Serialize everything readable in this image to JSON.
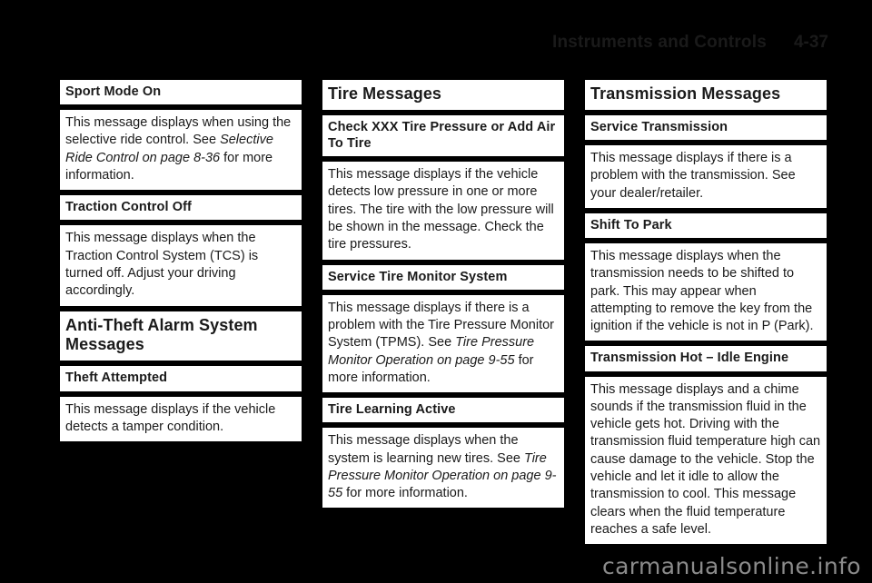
{
  "header": {
    "title": "Instruments and Controls",
    "folio": "4-37"
  },
  "columns": [
    {
      "id": "column-1",
      "blocks": [
        {
          "kind": "msg-title",
          "name": "heading-sport-mode-on",
          "text": "Sport Mode On"
        },
        {
          "kind": "body",
          "name": "body-sport-mode-on",
          "runs": [
            {
              "style": "normal",
              "text": "This message displays when using the selective ride control. See "
            },
            {
              "style": "italic",
              "text": "Selective Ride Control on page 8-36 "
            },
            {
              "style": "normal",
              "text": "for more information."
            }
          ]
        },
        {
          "kind": "msg-title",
          "name": "heading-traction-control-off",
          "text": "Traction Control Off"
        },
        {
          "kind": "body",
          "name": "body-traction-control-off",
          "runs": [
            {
              "style": "normal",
              "text": "This message displays when the Traction Control System (TCS) is turned off. Adjust your driving accordingly."
            }
          ]
        },
        {
          "kind": "sec-title",
          "name": "heading-anti-theft-alarm-system-messages",
          "text": "Anti-Theft Alarm System Messages"
        },
        {
          "kind": "msg-title",
          "name": "heading-theft-attempted",
          "text": "Theft Attempted"
        },
        {
          "kind": "body",
          "name": "body-theft-attempted",
          "runs": [
            {
              "style": "normal",
              "text": "This message displays if the vehicle detects a tamper condition."
            }
          ]
        }
      ]
    },
    {
      "id": "column-2",
      "blocks": [
        {
          "kind": "sec-title",
          "name": "heading-tire-messages",
          "text": "Tire Messages"
        },
        {
          "kind": "msg-title",
          "name": "heading-check-xxx-tire-pressure",
          "text": "Check XXX Tire Pressure or Add Air To Tire"
        },
        {
          "kind": "body",
          "name": "body-check-xxx-tire-pressure",
          "runs": [
            {
              "style": "normal",
              "text": "This message displays if the vehicle detects low pressure in one or more tires. The tire with the low pressure will be shown in the message. Check the tire pressures."
            }
          ]
        },
        {
          "kind": "msg-title",
          "name": "heading-service-tire-monitor-system",
          "text": "Service Tire Monitor System"
        },
        {
          "kind": "body",
          "name": "body-service-tire-monitor-system",
          "runs": [
            {
              "style": "normal",
              "text": "This message displays if there is a problem with the Tire Pressure Monitor System (TPMS). See "
            },
            {
              "style": "italic",
              "text": "Tire Pressure Monitor Operation on page 9-55 "
            },
            {
              "style": "normal",
              "text": "for more information."
            }
          ]
        },
        {
          "kind": "msg-title",
          "name": "heading-tire-learning-active",
          "text": "Tire Learning Active"
        },
        {
          "kind": "body",
          "name": "body-tire-learning-active",
          "runs": [
            {
              "style": "normal",
              "text": "This message displays when the system is learning new tires. See "
            },
            {
              "style": "italic",
              "text": "Tire Pressure Monitor Operation on page 9-55 "
            },
            {
              "style": "normal",
              "text": "for more information."
            }
          ]
        }
      ]
    },
    {
      "id": "column-3",
      "blocks": [
        {
          "kind": "sec-title",
          "name": "heading-transmission-messages",
          "text": "Transmission Messages"
        },
        {
          "kind": "msg-title",
          "name": "heading-service-transmission",
          "text": "Service Transmission"
        },
        {
          "kind": "body",
          "name": "body-service-transmission",
          "runs": [
            {
              "style": "normal",
              "text": "This message displays if there is a problem with the transmission. See your dealer/retailer."
            }
          ]
        },
        {
          "kind": "msg-title",
          "name": "heading-shift-to-park",
          "text": "Shift To Park"
        },
        {
          "kind": "body",
          "name": "body-shift-to-park",
          "runs": [
            {
              "style": "normal",
              "text": "This message displays when the transmission needs to be shifted to park. This may appear when attempting to remove the key from the ignition if the vehicle is not in P (Park)."
            }
          ]
        },
        {
          "kind": "msg-title",
          "name": "heading-transmission-hot-idle-engine",
          "text": "Transmission Hot – Idle Engine"
        },
        {
          "kind": "body",
          "name": "body-transmission-hot-idle-engine",
          "runs": [
            {
              "style": "normal",
              "text": "This message displays and a chime sounds if the transmission fluid in the vehicle gets hot. Driving with the transmission fluid temperature high can cause damage to the vehicle. Stop the vehicle and let it idle to allow the transmission to cool. This message clears when the fluid temperature reaches a safe level."
            }
          ]
        }
      ]
    }
  ],
  "watermark": {
    "text": "carmanualsonline.info"
  }
}
